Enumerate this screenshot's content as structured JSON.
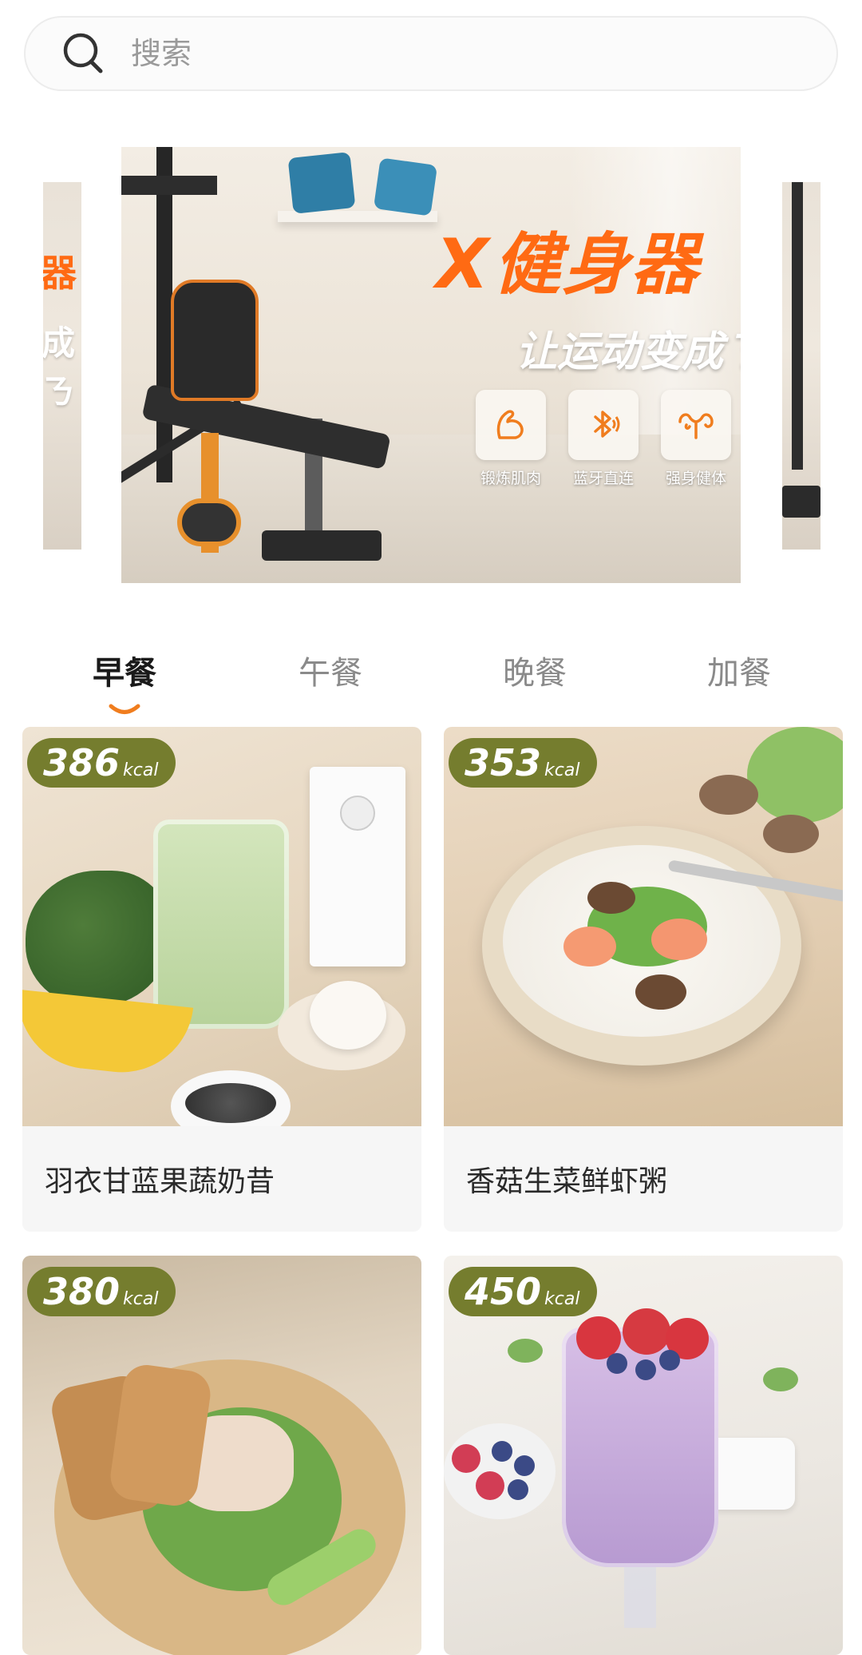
{
  "search": {
    "placeholder": "搜索",
    "icon": "search-icon"
  },
  "banner": {
    "brand_logo": "X",
    "brand_title": "健身器",
    "slogan": "让运动变成ㄋ",
    "features": [
      {
        "label": "锻炼肌肉",
        "icon": "muscle-arm-icon"
      },
      {
        "label": "蓝牙直连",
        "icon": "bluetooth-icon"
      },
      {
        "label": "强身健体",
        "icon": "strong-body-icon"
      }
    ],
    "peek_left_text1": "器",
    "peek_left_text2": "成ㄋ",
    "brand_color": "#ff6a13"
  },
  "tabs": {
    "items": [
      {
        "label": "早餐",
        "active": true
      },
      {
        "label": "午餐",
        "active": false
      },
      {
        "label": "晚餐",
        "active": false
      },
      {
        "label": "加餐",
        "active": false
      }
    ],
    "indicator_color": "#f07d1e"
  },
  "meals": [
    {
      "kcal": "386",
      "unit": "kcal",
      "name": "羽衣甘蓝果蔬奶昔"
    },
    {
      "kcal": "353",
      "unit": "kcal",
      "name": "香菇生菜鲜虾粥"
    },
    {
      "kcal": "380",
      "unit": "kcal",
      "name": ""
    },
    {
      "kcal": "450",
      "unit": "kcal",
      "name": ""
    }
  ],
  "colors": {
    "kcal_badge": "#757d2e",
    "card_bg": "#f6f6f6"
  }
}
